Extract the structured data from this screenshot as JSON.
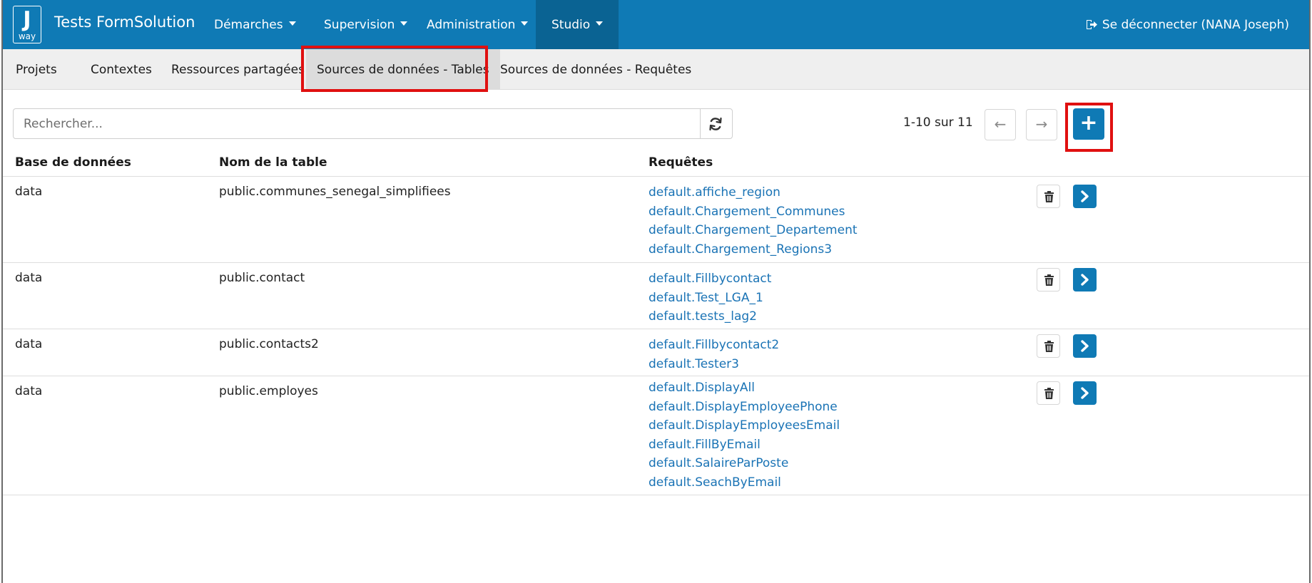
{
  "app": {
    "logo_letter": "J",
    "logo_sub": "way",
    "brand": "Tests FormSolution"
  },
  "nav": {
    "items": [
      {
        "label": "Démarches"
      },
      {
        "label": "Supervision"
      },
      {
        "label": "Administration"
      },
      {
        "label": "Studio"
      }
    ],
    "logout": "Se déconnecter (NANA Joseph)"
  },
  "subnav": {
    "items": [
      {
        "label": "Projets"
      },
      {
        "label": "Contextes"
      },
      {
        "label": "Ressources partagées"
      },
      {
        "label": "Sources de données - Tables"
      },
      {
        "label": "Sources de données - Requêtes"
      }
    ]
  },
  "search": {
    "placeholder": "Rechercher...",
    "value": ""
  },
  "pagination": {
    "text": "1-10 sur 11",
    "prev": "←",
    "next": "→",
    "add": "+"
  },
  "table": {
    "headers": [
      "Base de données",
      "Nom de la table",
      "Requêtes"
    ],
    "rows": [
      {
        "db": "data",
        "table": "public.communes_senegal_simplifiees",
        "queries": [
          "default.affiche_region",
          "default.Chargement_Communes",
          "default.Chargement_Departement",
          "default.Chargement_Regions3"
        ]
      },
      {
        "db": "data",
        "table": "public.contact",
        "queries": [
          "default.Fillbycontact",
          "default.Test_LGA_1",
          "default.tests_lag2"
        ]
      },
      {
        "db": "data",
        "table": "public.contacts2",
        "queries": [
          "default.Fillbycontact2",
          "default.Tester3"
        ]
      },
      {
        "db": "data",
        "table": "public.employes",
        "queries": [
          "default.DisplayAll",
          "default.DisplayEmployeePhone",
          "default.DisplayEmployeesEmail",
          "default.FillByEmail",
          "default.SalaireParPoste",
          "default.SeachByEmail"
        ]
      }
    ]
  },
  "colors": {
    "primary": "#0f7ab5",
    "link": "#1a73b5",
    "highlight": "#e01010"
  }
}
